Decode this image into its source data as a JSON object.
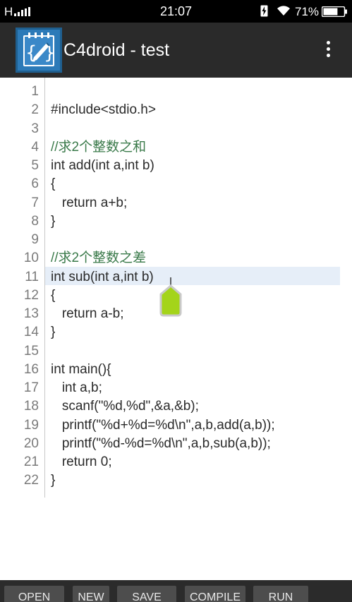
{
  "status_bar": {
    "signal_label": "H",
    "time": "21:07",
    "battery_percent": "71%",
    "battery_level": 0.71,
    "icons": [
      "signal-bars-icon",
      "charging-bolt-icon",
      "wifi-icon",
      "battery-icon"
    ]
  },
  "app_bar": {
    "title": "C4droid - test",
    "logo_icon": "c4droid-logo-icon",
    "menu_icon": "overflow-menu-icon"
  },
  "editor": {
    "lines": [
      {
        "n": "1",
        "text": "",
        "kind": "code"
      },
      {
        "n": "2",
        "text": "#include<stdio.h>",
        "kind": "code"
      },
      {
        "n": "3",
        "text": "",
        "kind": "code"
      },
      {
        "n": "4",
        "text": "//求2个整数之和",
        "kind": "comment"
      },
      {
        "n": "5",
        "text": "int add(int a,int b)",
        "kind": "code"
      },
      {
        "n": "6",
        "text": "{",
        "kind": "code"
      },
      {
        "n": "7",
        "text": "   return a+b;",
        "kind": "code"
      },
      {
        "n": "8",
        "text": "}",
        "kind": "code"
      },
      {
        "n": "9",
        "text": "",
        "kind": "code"
      },
      {
        "n": "10",
        "text": "//求2个整数之差",
        "kind": "comment"
      },
      {
        "n": "11",
        "text": "int sub(int a,int b)",
        "kind": "code"
      },
      {
        "n": "12",
        "text": "{",
        "kind": "code"
      },
      {
        "n": "13",
        "text": "   return a-b;",
        "kind": "code"
      },
      {
        "n": "14",
        "text": "}",
        "kind": "code"
      },
      {
        "n": "15",
        "text": "",
        "kind": "code"
      },
      {
        "n": "16",
        "text": "int main(){",
        "kind": "code"
      },
      {
        "n": "17",
        "text": "   int a,b;",
        "kind": "code"
      },
      {
        "n": "18",
        "text": "   scanf(\"%d,%d\",&a,&b);",
        "kind": "code"
      },
      {
        "n": "19",
        "text": "   printf(\"%d+%d=%d\\n\",a,b,add(a,b));",
        "kind": "code"
      },
      {
        "n": "20",
        "text": "   printf(\"%d-%d=%d\\n\",a,b,sub(a,b));",
        "kind": "code"
      },
      {
        "n": "21",
        "text": "   return 0;",
        "kind": "code"
      },
      {
        "n": "22",
        "text": "}",
        "kind": "code"
      }
    ],
    "current_line": "11"
  },
  "bottom_bar": {
    "buttons": [
      "OPEN",
      "NEW",
      "SAVE",
      "COMPILE",
      "RUN"
    ]
  },
  "colors": {
    "status_bg": "#000000",
    "appbar_bg": "#2a2a2a",
    "comment": "#3a7a4a",
    "line_number": "#7a7a7a",
    "current_line_highlight": "#e6eef8",
    "cursor_handle": "#a4d41a",
    "bottom_bg": "#2b2b2b",
    "button_bg": "#4d4d4d"
  }
}
